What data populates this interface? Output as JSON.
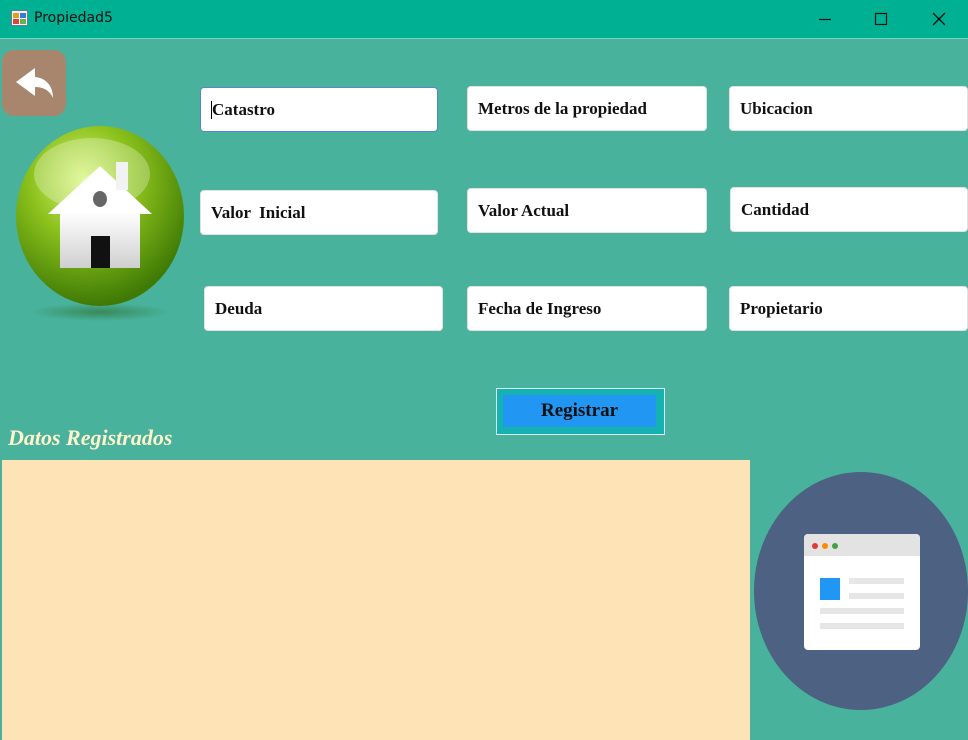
{
  "window": {
    "title": "Propiedad5",
    "controls": [
      "minimize-icon",
      "maximize-icon",
      "close-icon"
    ]
  },
  "colors": {
    "titlebar": "#00b092",
    "background": "#48b29c",
    "register_button": "#2196f3",
    "records_panel": "#fde3b5",
    "heading": "#fff3cc"
  },
  "form": {
    "fields": {
      "catastro": "Catastro",
      "metros": "Metros de la propiedad",
      "ubicacion": "Ubicacion",
      "valor_inicial": "Valor  Inicial",
      "valor_actual": "Valor Actual",
      "cantidad": "Cantidad",
      "deuda": "Deuda",
      "fecha_ingreso": "Fecha de Ingreso",
      "propietario": "Propietario"
    },
    "register_label": "Registrar"
  },
  "records": {
    "heading": "Datos Registrados"
  },
  "icons": {
    "back": "back-arrow-icon",
    "house": "house-icon",
    "document": "browser-document-icon"
  }
}
